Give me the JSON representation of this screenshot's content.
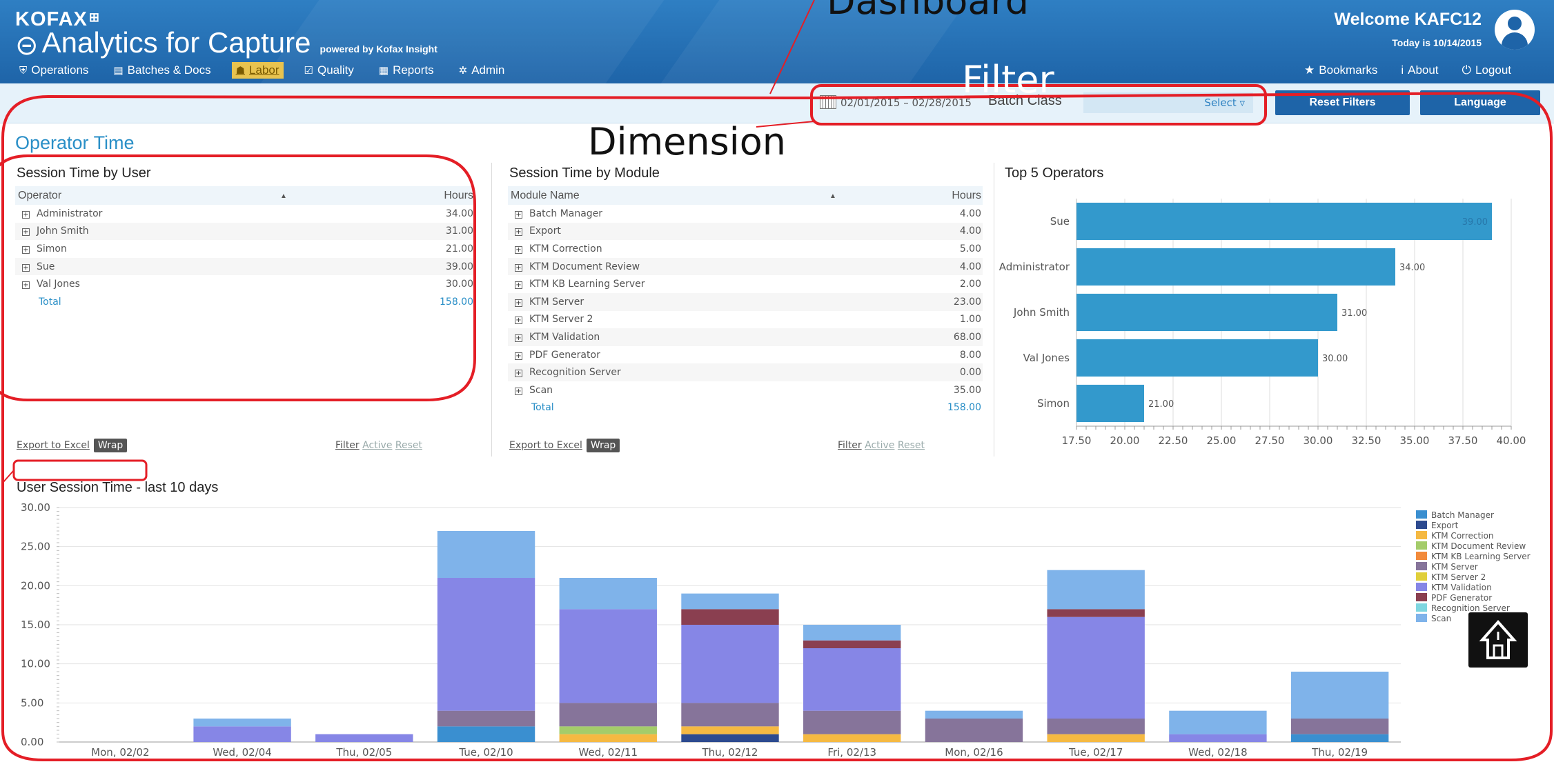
{
  "header": {
    "brand": "KOFAX",
    "app_title": "Analytics for Capture",
    "powered_by": "powered by Kofax Insight",
    "welcome": "Welcome KAFC12",
    "today": "Today is 10/14/2015",
    "nav": [
      {
        "label": "Operations",
        "icon": "chart-icon"
      },
      {
        "label": "Batches & Docs",
        "icon": "document-icon"
      },
      {
        "label": "Labor",
        "icon": "people-icon",
        "active": true
      },
      {
        "label": "Quality",
        "icon": "checkbox-icon"
      },
      {
        "label": "Reports",
        "icon": "report-icon"
      },
      {
        "label": "Admin",
        "icon": "gear-icon"
      }
    ],
    "links": [
      {
        "label": "Bookmarks",
        "icon": "star-icon"
      },
      {
        "label": "About",
        "icon": "info-icon"
      },
      {
        "label": "Logout",
        "icon": "power-icon"
      }
    ]
  },
  "filters": {
    "date_range": "02/01/2015 – 02/28/2015",
    "batch_class_label": "Batch Class",
    "batch_class_value": "Select ▿",
    "reset_label": "Reset Filters",
    "language_label": "Language"
  },
  "page_title": "Operator Time",
  "annotations": {
    "dashboard": "Dashboard",
    "filter": "Filter",
    "dimension": "Dimension"
  },
  "session_by_user": {
    "title": "Session Time by User",
    "col1": "Operator",
    "col2": "Hours",
    "rows": [
      {
        "name": "Administrator",
        "hours": "34.00"
      },
      {
        "name": "John Smith",
        "hours": "31.00"
      },
      {
        "name": "Simon",
        "hours": "21.00"
      },
      {
        "name": "Sue",
        "hours": "39.00"
      },
      {
        "name": "Val Jones",
        "hours": "30.00"
      }
    ],
    "total_label": "Total",
    "total": "158.00"
  },
  "session_by_module": {
    "title": "Session Time by Module",
    "col1": "Module Name",
    "col2": "Hours",
    "rows": [
      {
        "name": "Batch Manager",
        "hours": "4.00"
      },
      {
        "name": "Export",
        "hours": "4.00"
      },
      {
        "name": "KTM Correction",
        "hours": "5.00"
      },
      {
        "name": "KTM Document Review",
        "hours": "4.00"
      },
      {
        "name": "KTM KB Learning Server",
        "hours": "2.00"
      },
      {
        "name": "KTM Server",
        "hours": "23.00"
      },
      {
        "name": "KTM Server 2",
        "hours": "1.00"
      },
      {
        "name": "KTM Validation",
        "hours": "68.00"
      },
      {
        "name": "PDF Generator",
        "hours": "8.00"
      },
      {
        "name": "Recognition Server",
        "hours": "0.00"
      },
      {
        "name": "Scan",
        "hours": "35.00"
      }
    ],
    "total_label": "Total",
    "total": "158.00"
  },
  "footer": {
    "export": "Export to Excel",
    "wrap": "Wrap",
    "filter": "Filter",
    "active": "Active",
    "reset": "Reset"
  },
  "chart_data": [
    {
      "type": "bar",
      "title": "Top 5 Operators",
      "orientation": "horizontal",
      "categories": [
        "Sue",
        "Administrator",
        "John Smith",
        "Val Jones",
        "Simon"
      ],
      "values": [
        39.0,
        34.0,
        31.0,
        30.0,
        21.0
      ],
      "data_labels": [
        "39.00",
        "34.00",
        "31.00",
        "30.00",
        "21.00"
      ],
      "xlim": [
        17.5,
        40.0
      ],
      "xticks": [
        "17.50",
        "20.00",
        "22.50",
        "25.00",
        "27.50",
        "30.00",
        "32.50",
        "35.00",
        "37.50",
        "40.00"
      ],
      "grid": true,
      "color": "#3399cc"
    },
    {
      "type": "bar",
      "stacked": true,
      "title": "User Session Time - last 10 days",
      "categories": [
        "Mon, 02/02",
        "Wed, 02/04",
        "Thu, 02/05",
        "Tue, 02/10",
        "Wed, 02/11",
        "Thu, 02/12",
        "Fri, 02/13",
        "Mon, 02/16",
        "Tue, 02/17",
        "Wed, 02/18",
        "Thu, 02/19"
      ],
      "ylim": [
        0,
        30
      ],
      "yticks": [
        "0.00",
        "5.00",
        "10.00",
        "15.00",
        "20.00",
        "25.00",
        "30.00"
      ],
      "legend_position": "right",
      "series": [
        {
          "name": "Batch Manager",
          "color": "#3a8fd0",
          "values": [
            0,
            0,
            0,
            2,
            0,
            0,
            0,
            0,
            0,
            0,
            1
          ]
        },
        {
          "name": "Export",
          "color": "#2c4a8f",
          "values": [
            0,
            0,
            0,
            0,
            0,
            1,
            0,
            0,
            0,
            0,
            0
          ]
        },
        {
          "name": "KTM Correction",
          "color": "#f5b942",
          "values": [
            0,
            0,
            0,
            0,
            1,
            1,
            1,
            0,
            1,
            0,
            0
          ]
        },
        {
          "name": "KTM Document Review",
          "color": "#a4cc6a",
          "values": [
            0,
            0,
            0,
            0,
            1,
            0,
            0,
            0,
            0,
            0,
            0
          ]
        },
        {
          "name": "KTM KB Learning Server",
          "color": "#f28a3b",
          "values": [
            0,
            0,
            0,
            0,
            0,
            0,
            0,
            0,
            0,
            0,
            0
          ]
        },
        {
          "name": "KTM Server",
          "color": "#86749a",
          "values": [
            0,
            0,
            0,
            2,
            3,
            3,
            3,
            3,
            2,
            0,
            2
          ]
        },
        {
          "name": "KTM Server 2",
          "color": "#e0cf3a",
          "values": [
            0,
            0,
            0,
            0,
            0,
            0,
            0,
            0,
            0,
            0,
            0
          ]
        },
        {
          "name": "KTM Validation",
          "color": "#8686e6",
          "values": [
            0,
            2,
            1,
            17,
            12,
            10,
            8,
            0,
            13,
            1,
            0
          ]
        },
        {
          "name": "PDF Generator",
          "color": "#8a3f50",
          "values": [
            0,
            0,
            0,
            0,
            0,
            2,
            1,
            0,
            1,
            0,
            0
          ]
        },
        {
          "name": "Recognition Server",
          "color": "#7fd6e0",
          "values": [
            0,
            0,
            0,
            0,
            0,
            0,
            0,
            0,
            0,
            0,
            0
          ]
        },
        {
          "name": "Scan",
          "color": "#7fb3ea",
          "values": [
            0,
            1,
            0,
            6,
            4,
            2,
            2,
            1,
            5,
            3,
            6
          ]
        }
      ]
    }
  ]
}
